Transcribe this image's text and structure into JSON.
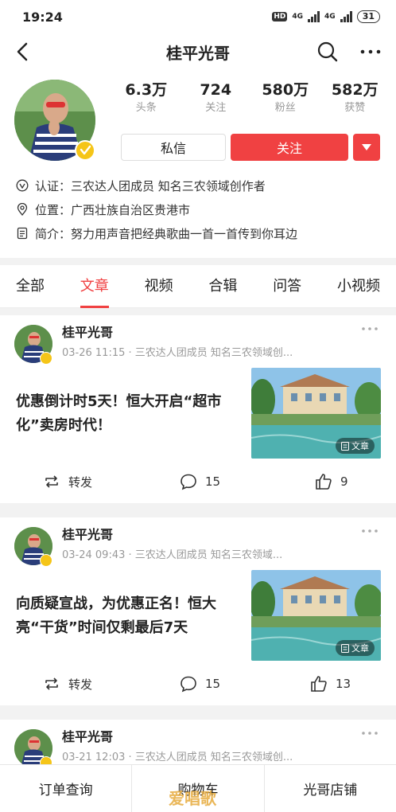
{
  "status_bar": {
    "time": "19:24",
    "hd": "HD",
    "net1": "4G",
    "net2": "4G",
    "battery": "31"
  },
  "nav": {
    "title": "桂平光哥"
  },
  "profile": {
    "stats": [
      {
        "value": "6.3万",
        "label": "头条"
      },
      {
        "value": "724",
        "label": "关注"
      },
      {
        "value": "580万",
        "label": "粉丝"
      },
      {
        "value": "582万",
        "label": "获赞"
      }
    ],
    "message_label": "私信",
    "follow_label": "关注",
    "info": [
      {
        "label": "认证：",
        "text": "三农达人团成员 知名三农领域创作者"
      },
      {
        "label": "位置：",
        "text": "广西壮族自治区贵港市"
      },
      {
        "label": "简介：",
        "text": "努力用声音把经典歌曲一首一首传到你耳边"
      }
    ]
  },
  "tabs": [
    "全部",
    "文章",
    "视频",
    "合辑",
    "问答",
    "小视频"
  ],
  "posts": [
    {
      "author": "桂平光哥",
      "meta": "03-26 11:15 · 三农达人团成员 知名三农领域创...",
      "title": "优惠倒计时5天！恒大开启“超市化”卖房时代！",
      "thumb_label": "文章",
      "repost": "转发",
      "comments": "15",
      "likes": "9"
    },
    {
      "author": "桂平光哥",
      "meta": "03-24 09:43 · 三农达人团成员 知名三农领域...",
      "title": "向质疑宣战，为优惠正名！恒大亮“干货”时间仅剩最后7天",
      "thumb_label": "文章",
      "repost": "转发",
      "comments": "15",
      "likes": "13"
    },
    {
      "author": "桂平光哥",
      "meta": "03-21 12:03 · 三农达人团成员 知名三农领域创..."
    }
  ],
  "bottom_bar": [
    "订单查询",
    "购物车",
    "光哥店铺"
  ],
  "watermark": "爱唱歌",
  "colors": {
    "accent": "#f04142",
    "badge": "#f5c518"
  }
}
